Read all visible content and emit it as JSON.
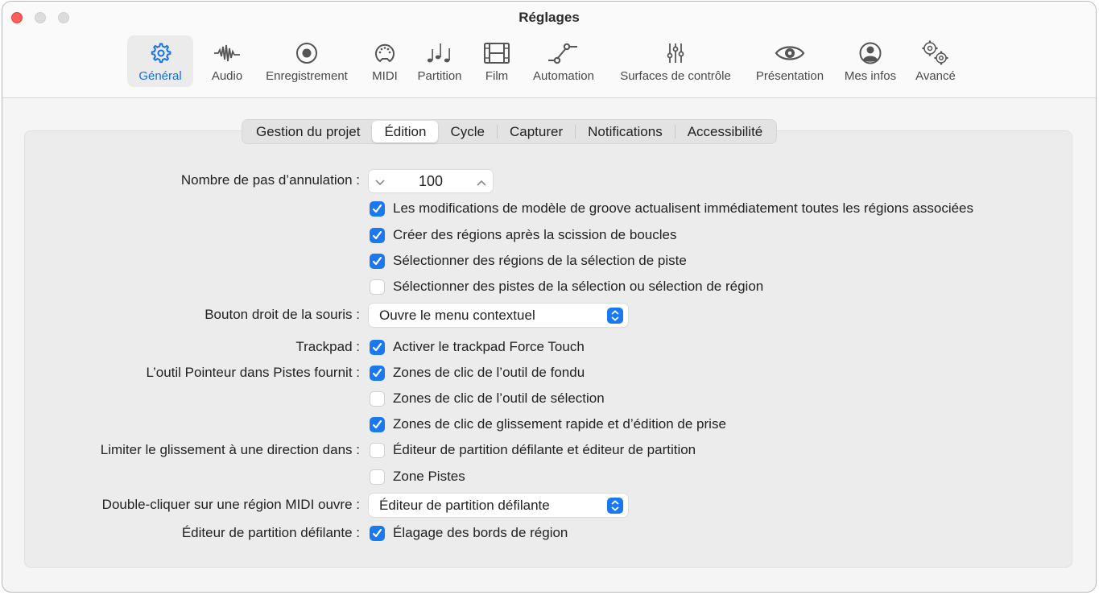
{
  "window": {
    "title": "Réglages"
  },
  "toolbar": {
    "items": [
      {
        "label": "Général",
        "icon": "gear-icon",
        "active": true
      },
      {
        "label": "Audio",
        "icon": "waveform-icon"
      },
      {
        "label": "Enregistrement",
        "icon": "record-icon"
      },
      {
        "label": "MIDI",
        "icon": "midi-connector-icon"
      },
      {
        "label": "Partition",
        "icon": "music-notes-icon"
      },
      {
        "label": "Film",
        "icon": "film-icon"
      },
      {
        "label": "Automation",
        "icon": "automation-curve-icon"
      },
      {
        "label": "Surfaces de contrôle",
        "icon": "sliders-icon"
      },
      {
        "label": "Présentation",
        "icon": "eye-icon"
      },
      {
        "label": "Mes infos",
        "icon": "person-circle-icon"
      },
      {
        "label": "Avancé",
        "icon": "gears-icon"
      }
    ]
  },
  "tabs": [
    {
      "label": "Gestion du projet"
    },
    {
      "label": "Édition",
      "selected": true
    },
    {
      "label": "Cycle"
    },
    {
      "label": "Capturer"
    },
    {
      "label": "Notifications"
    },
    {
      "label": "Accessibilité"
    }
  ],
  "settings": {
    "undo_steps": {
      "label": "Nombre de pas d’annulation :",
      "value": "100"
    },
    "groove_update": {
      "label": "Les modifications de modèle de groove actualisent immédiatement toutes les régions associées",
      "checked": true
    },
    "create_regions": {
      "label": "Créer des régions après la scission de boucles",
      "checked": true
    },
    "select_regions": {
      "label": "Sélectionner des régions de la sélection de piste",
      "checked": true
    },
    "select_tracks": {
      "label": "Sélectionner des pistes de la sélection ou sélection de région",
      "checked": false
    },
    "right_mouse": {
      "label": "Bouton droit de la souris :",
      "value": "Ouvre le menu contextuel"
    },
    "trackpad": {
      "label": "Trackpad :",
      "option": "Activer le trackpad Force Touch",
      "checked": true
    },
    "pointer_tool": {
      "label": "L’outil Pointeur dans Pistes fournit :",
      "options": [
        {
          "label": "Zones de clic de l’outil de fondu",
          "checked": true
        },
        {
          "label": "Zones de clic de l’outil de sélection",
          "checked": false
        },
        {
          "label": "Zones de clic de glissement rapide et d’édition de prise",
          "checked": true
        }
      ]
    },
    "limit_drag": {
      "label": "Limiter le glissement à une direction dans :",
      "options": [
        {
          "label": "Éditeur de partition défilante et éditeur de partition",
          "checked": false
        },
        {
          "label": "Zone Pistes",
          "checked": false
        }
      ]
    },
    "double_click_midi": {
      "label": "Double-cliquer sur une région MIDI ouvre :",
      "value": "Éditeur de partition défilante"
    },
    "piano_roll": {
      "label": "Éditeur de partition défilante :",
      "option": "Élagage des bords de région",
      "checked": true
    }
  },
  "colors": {
    "accent": "#1a78f0",
    "active_label": "#1a6fe6"
  }
}
